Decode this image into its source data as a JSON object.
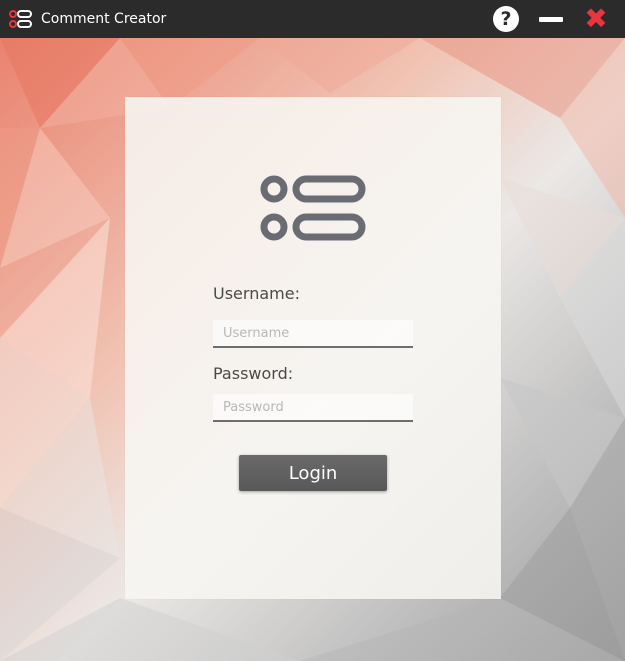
{
  "window": {
    "title": "Comment Creator",
    "app_icon": "comment-creator-logo-icon",
    "controls": {
      "help_symbol": "?",
      "close_symbol": "✖",
      "close_color": "#e8363f"
    }
  },
  "login": {
    "logo_icon": "comment-creator-logo-icon",
    "username_label": "Username:",
    "username_placeholder": "Username",
    "username_value": "",
    "password_label": "Password:",
    "password_placeholder": "Password",
    "password_value": "",
    "login_label": "Login"
  },
  "colors": {
    "titlebar": "#2b2b2b",
    "accent_close": "#e8363f",
    "logo": "#6b6b73",
    "button": "#5f5f5f"
  }
}
